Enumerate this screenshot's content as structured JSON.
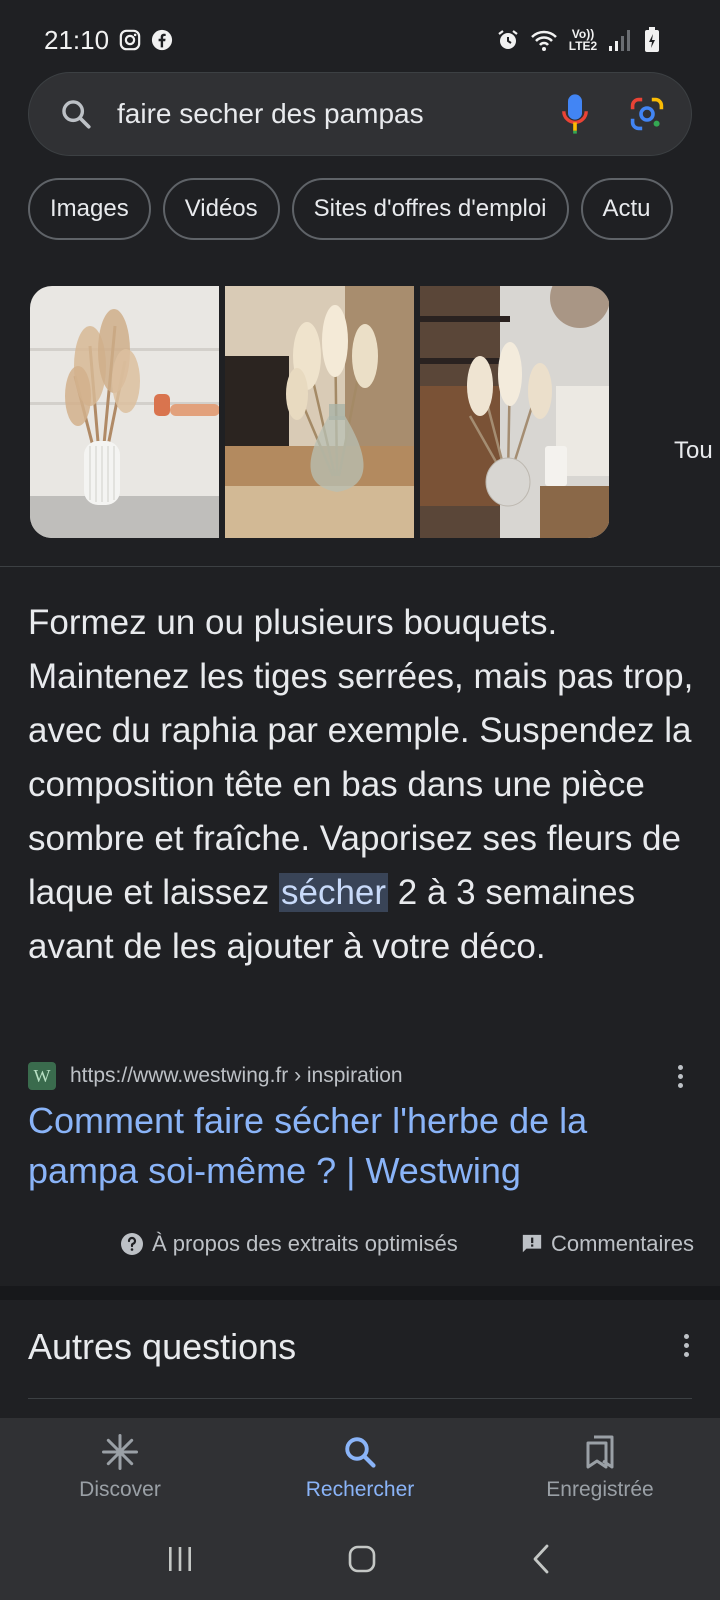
{
  "status_bar": {
    "time": "21:10",
    "network_label": "Vo)) LTE2",
    "icons": [
      "instagram-icon",
      "facebook-icon",
      "alarm-icon",
      "wifi-icon",
      "signal-icon",
      "battery-icon"
    ]
  },
  "search": {
    "query": "faire secher des pampas"
  },
  "chips": [
    "Images",
    "Vidéos",
    "Sites d'offres d'emploi",
    "Actu"
  ],
  "images": {
    "more_label": "Tou"
  },
  "snippet": {
    "before": "Formez un ou plusieurs bouquets. Maintenez les tiges serrées, mais pas trop, avec du raphia par exemple. Suspendez la composition tête en bas dans une pièce sombre et fraîche. Vaporisez ses fleurs de laque et laissez ",
    "highlight": "sécher",
    "after": " 2 à 3 semaines avant de les ajouter à votre déco."
  },
  "source": {
    "favicon_letter": "W",
    "url": "https://www.westwing.fr › inspiration",
    "title": "Comment faire sécher l'herbe de la pampa soi-même ? | Westwing"
  },
  "meta": {
    "about": "À propos des extraits optimisés",
    "feedback": "Commentaires"
  },
  "section": {
    "title": "Autres questions"
  },
  "bottom_nav": [
    {
      "label": "Discover",
      "icon": "discover-icon",
      "active": false
    },
    {
      "label": "Rechercher",
      "icon": "search-icon",
      "active": true
    },
    {
      "label": "Enregistrée",
      "icon": "bookmarks-icon",
      "active": false
    }
  ],
  "colors": {
    "background": "#1f2023",
    "link": "#8ab4f8",
    "highlight_bg": "#394457"
  }
}
